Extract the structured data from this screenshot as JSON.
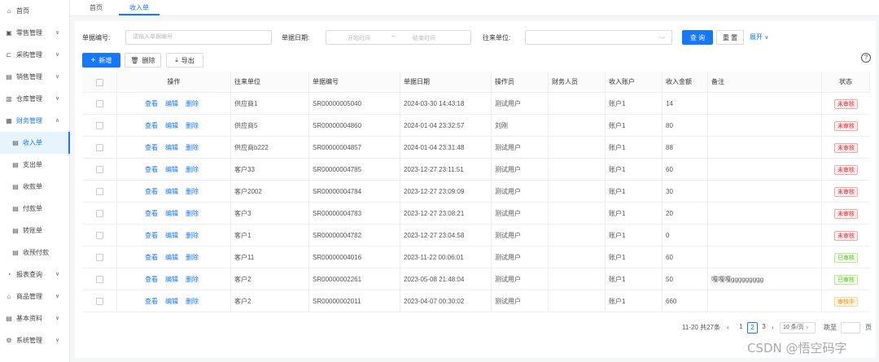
{
  "sidebar": {
    "items": [
      {
        "label": "首页",
        "icon": "home-icon",
        "chevron": false
      },
      {
        "label": "零售管理",
        "icon": "shop-icon",
        "chevron": true
      },
      {
        "label": "采购管理",
        "icon": "cart-icon",
        "chevron": true
      },
      {
        "label": "销售管理",
        "icon": "sales-icon",
        "chevron": true
      },
      {
        "label": "仓库管理",
        "icon": "warehouse-icon",
        "chevron": true
      },
      {
        "label": "财务管理",
        "icon": "finance-icon",
        "chevron": true,
        "open": true
      }
    ],
    "sub_items": [
      {
        "label": "收入单",
        "active": true
      },
      {
        "label": "支出单"
      },
      {
        "label": "收款单"
      },
      {
        "label": "付款单"
      },
      {
        "label": "转账单"
      },
      {
        "label": "收预付款"
      }
    ],
    "bottom_items": [
      {
        "label": "报表查询",
        "icon": "report-icon"
      },
      {
        "label": "商品管理",
        "icon": "goods-icon"
      },
      {
        "label": "基本资料",
        "icon": "profile-icon"
      },
      {
        "label": "系统管理",
        "icon": "settings-icon"
      }
    ]
  },
  "tabs": [
    {
      "label": "首页"
    },
    {
      "label": "收入单",
      "active": true
    }
  ],
  "search": {
    "bill_no_label": "单据编号:",
    "bill_no_placeholder": "请输入单据编号",
    "date_label": "单据日期:",
    "date_start_placeholder": "开始时间",
    "date_sep": "~",
    "date_end_placeholder": "结束时间",
    "partner_label": "往来单位:",
    "query_label": "查 询",
    "reset_label": "重 置",
    "expand_label": "展开"
  },
  "toolbar": {
    "add_label": "新增",
    "delete_label": "删除",
    "export_label": "导出"
  },
  "table": {
    "headers": [
      "操作",
      "往来单位",
      "单据编号",
      "单据日期",
      "操作员",
      "财务人员",
      "收入账户",
      "收入金额",
      "备注",
      "状态"
    ],
    "actions": [
      "查看",
      "编辑",
      "删除"
    ],
    "rows": [
      {
        "partner": "供应商1",
        "bill_no": "SR00000005040",
        "date": "2024-03-30 14:43:18",
        "operator": "测试用户",
        "finance": "",
        "account": "账户1",
        "amount": "14",
        "note": "",
        "status": "未审核",
        "status_type": "pending"
      },
      {
        "partner": "供应商5",
        "bill_no": "SR00000004860",
        "date": "2024-01-04 23:32:57",
        "operator": "刘刚",
        "finance": "",
        "account": "账户1",
        "amount": "80",
        "note": "",
        "status": "未审核",
        "status_type": "pending"
      },
      {
        "partner": "供应商b222",
        "bill_no": "SR00000004857",
        "date": "2024-01-04 23:31:48",
        "operator": "测试用户",
        "finance": "",
        "account": "账户1",
        "amount": "88",
        "note": "",
        "status": "未审核",
        "status_type": "pending"
      },
      {
        "partner": "客户33",
        "bill_no": "SR00000004785",
        "date": "2023-12-27 23:11:51",
        "operator": "测试用户",
        "finance": "",
        "account": "账户1",
        "amount": "60",
        "note": "",
        "status": "未审核",
        "status_type": "pending"
      },
      {
        "partner": "客户2002",
        "bill_no": "SR00000004784",
        "date": "2023-12-27 23:09:09",
        "operator": "测试用户",
        "finance": "",
        "account": "账户1",
        "amount": "30",
        "note": "",
        "status": "未审核",
        "status_type": "pending"
      },
      {
        "partner": "客户3",
        "bill_no": "SR00000004783",
        "date": "2023-12-27 23:08:21",
        "operator": "测试用户",
        "finance": "",
        "account": "账户1",
        "amount": "20",
        "note": "",
        "status": "未审核",
        "status_type": "pending"
      },
      {
        "partner": "客户1",
        "bill_no": "SR00000004782",
        "date": "2023-12-27 23:04:58",
        "operator": "测试用户",
        "finance": "",
        "account": "账户1",
        "amount": "0",
        "note": "",
        "status": "未审核",
        "status_type": "pending"
      },
      {
        "partner": "客户11",
        "bill_no": "SR00000004016",
        "date": "2023-11-22 00:06:01",
        "operator": "测试用户",
        "finance": "",
        "account": "账户1",
        "amount": "60",
        "note": "",
        "status": "已审核",
        "status_type": "done"
      },
      {
        "partner": "客户2",
        "bill_no": "SR00000002261",
        "date": "2023-05-08 21:48:04",
        "operator": "测试用户",
        "finance": "",
        "account": "账户1",
        "amount": "50",
        "note": "嘎嘎嘎ggggggggg",
        "status": "已审核",
        "status_type": "done"
      },
      {
        "partner": "客户2",
        "bill_no": "SR00000002011",
        "date": "2023-04-07 00:30:02",
        "operator": "测试用户",
        "finance": "",
        "account": "账户1",
        "amount": "660",
        "note": "",
        "status": "审核中",
        "status_type": "review"
      }
    ]
  },
  "pagination": {
    "summary": "11-20 共27条",
    "pages": [
      "1",
      "2",
      "3"
    ],
    "current_page": "2",
    "page_size": "10 条/页",
    "jump_label": "跳至",
    "page_suffix": "页"
  },
  "watermark": "CSDN @悟空码字",
  "colors": {
    "accent": "#1677ff",
    "pending": "#f5222d",
    "done": "#52c41a",
    "review": "#fa8c16"
  }
}
